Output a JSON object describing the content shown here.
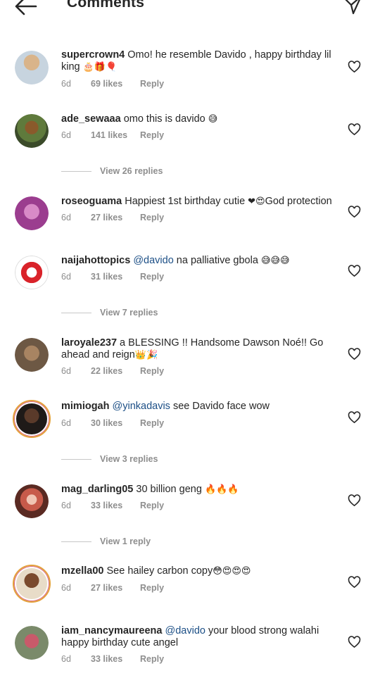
{
  "header": {
    "title": "Comments",
    "back_icon": "arrow-left-icon",
    "share_icon": "paper-plane-icon"
  },
  "comments": [
    {
      "username": "supercrown4",
      "text": "Omo!  he resemble Davido , happy birthday lil king ",
      "emoji": "🎂🎁🎈",
      "time": "6d",
      "likes": "69 likes",
      "reply": "Reply"
    },
    {
      "username": "ade_sewaaa",
      "text": "omo this is davido ",
      "emoji": "😅",
      "time": "6d",
      "likes": "141 likes",
      "reply": "Reply"
    },
    {
      "username": "roseoguama",
      "text": "Happiest 1st birthday cutie ",
      "emoji": "❤😍",
      "text2": "God protection",
      "time": "6d",
      "likes": "27 likes",
      "reply": "Reply"
    },
    {
      "username": "naijahottopics",
      "mention": "@davido",
      "text": " na palliative gbola ",
      "emoji": "😅😅😅",
      "time": "6d",
      "likes": "31 likes",
      "reply": "Reply"
    },
    {
      "username": "laroyale237",
      "text": "a BLESSING !! Handsome Dawson Noé!! Go ahead and reign",
      "emoji": "👑🎉",
      "time": "6d",
      "likes": "22 likes",
      "reply": "Reply"
    },
    {
      "username": "mimiogah",
      "mention": "@yinkadavis",
      "text": " see Davido face wow",
      "emoji": "",
      "time": "6d",
      "likes": "30 likes",
      "reply": "Reply"
    },
    {
      "username": "mag_darling05",
      "text": "30 billion geng ",
      "emoji": "🔥🔥🔥",
      "time": "6d",
      "likes": "33 likes",
      "reply": "Reply"
    },
    {
      "username": "mzella00",
      "text": "See hailey carbon copy",
      "emoji": "😳😍😍😍",
      "time": "6d",
      "likes": "27 likes",
      "reply": "Reply"
    },
    {
      "username": "iam_nancymaureena",
      "mention": "@davido",
      "text": " your blood strong walahi happy birthday cute angel",
      "emoji": "",
      "time": "6d",
      "likes": "33 likes",
      "reply": "Reply"
    }
  ],
  "replies": [
    {
      "label": "View 26 replies"
    },
    {
      "label": "View 7 replies"
    },
    {
      "label": "View 3 replies"
    },
    {
      "label": "View 1 reply"
    }
  ],
  "colors": {
    "text": "#262626",
    "secondary": "#8e8e8e",
    "mention": "#1c4f86",
    "divider": "#c7c7c7"
  }
}
